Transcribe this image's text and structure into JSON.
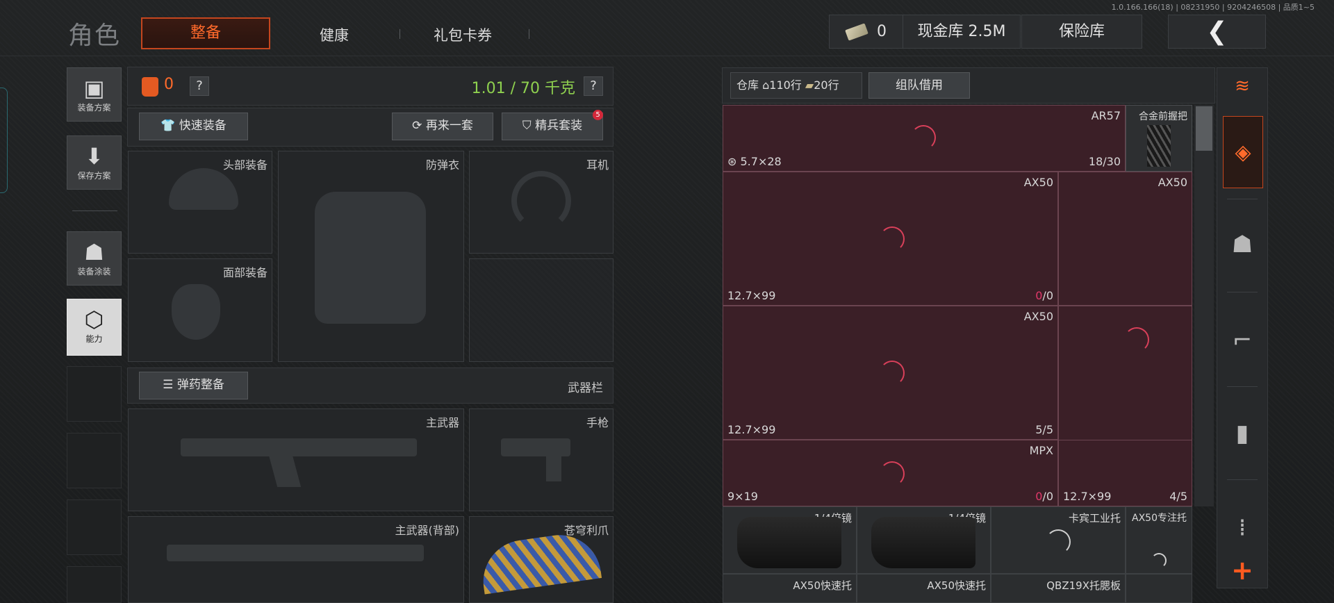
{
  "version": "1.0.166.166(18) | 08231950 | 9204246508 | 品质1~5",
  "header": {
    "title": "角色",
    "tabs": [
      {
        "label": "整备",
        "active": true
      },
      {
        "label": "健康",
        "active": false
      },
      {
        "label": "礼包卡券",
        "active": false
      }
    ],
    "currency_value": "0",
    "cash_storage": "现金库 2.5M",
    "safe_storage": "保险库",
    "back_icon": "chevron-left-icon"
  },
  "sidebar": {
    "items": [
      {
        "label": "装备方案",
        "icon": "vest-icon"
      },
      {
        "label": "保存方案",
        "icon": "download-icon"
      },
      {
        "label": "装备涂装",
        "icon": "helmet-paint-icon"
      },
      {
        "label": "能力",
        "icon": "ability-icon"
      }
    ]
  },
  "loadout": {
    "armor_count": "0",
    "help": "?",
    "weight": "1.01 / 70 千克",
    "quick_equip": "快速装备",
    "redo": "再来一套",
    "elite_set": "精兵套装",
    "elite_badge": "5",
    "slots": {
      "head": "头部装备",
      "vest": "防弹衣",
      "headset": "耳机",
      "face": "面部装备"
    },
    "ammo_button": "弹药整备",
    "weapon_bar": "武器栏",
    "weapons": {
      "primary": "主武器",
      "pistol": "手枪",
      "primary_back": "主武器(背部)",
      "melee": "苍穹利爪"
    }
  },
  "warehouse": {
    "label": "仓库",
    "rows": "110行",
    "rows_icon": "house-icon",
    "cols": "20行",
    "cols_icon": "ammo-icon",
    "team_borrow": "组队借用",
    "items": [
      {
        "name": "AR57",
        "caliber": "5.7×28",
        "count": "18/30"
      },
      {
        "name": "合金前握把"
      },
      {
        "name": "AX50",
        "caliber": "12.7×99",
        "count_cur": "0",
        "count_max": "/0"
      },
      {
        "name": "AX50"
      },
      {
        "name": "AX50",
        "caliber": "12.7×99",
        "count": "5/5"
      },
      {
        "name": "MPX",
        "caliber": "9×19",
        "count_cur": "0",
        "count_max": "/0"
      },
      {
        "caliber": "12.7×99",
        "count": "4/5"
      }
    ],
    "attachments": [
      {
        "name": "1/4倍镜"
      },
      {
        "name": "1/4倍镜"
      },
      {
        "name": "卡宾工业托"
      },
      {
        "name": "AX50专注托"
      },
      {
        "name": "AX50快速托"
      },
      {
        "name": "AX50快速托"
      },
      {
        "name": "QBZ19X托腮板"
      }
    ]
  },
  "colors": {
    "accent": "#ff6a2b",
    "weight_green": "#8fd14f",
    "warehouse_bg": "#3b1f27",
    "count_red": "#e0386a"
  }
}
